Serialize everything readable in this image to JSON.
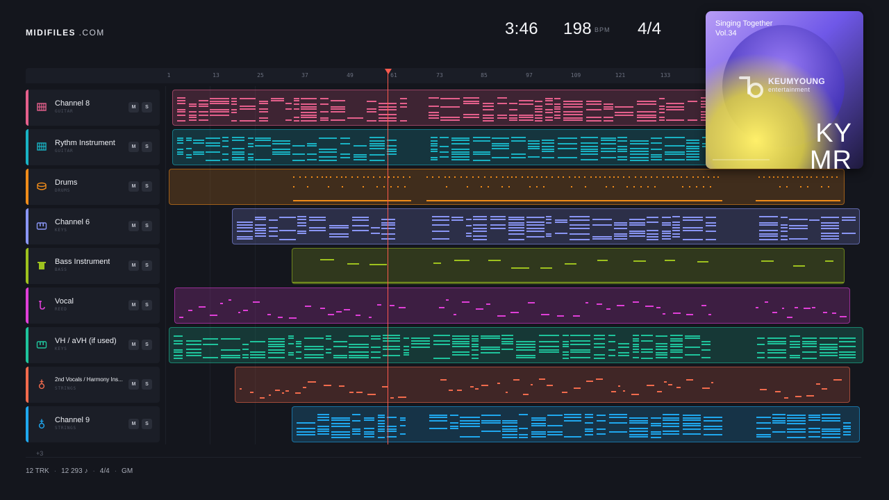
{
  "brand": {
    "name": "MIDIFILES",
    "suffix": ".COM"
  },
  "transport": {
    "time": "3:46",
    "bpm": "198",
    "bpm_unit": "BPM",
    "signature": "4/4"
  },
  "ruler": {
    "ticks": [
      "1",
      "13",
      "25",
      "37",
      "49",
      "61",
      "73",
      "85",
      "97",
      "109",
      "121",
      "133"
    ]
  },
  "tracks": [
    {
      "name": "Channel 8",
      "type": "GUITAR",
      "icon": "guitar-grid-icon",
      "color": "#e5608c",
      "mute": "M",
      "solo": "S"
    },
    {
      "name": "Rythm Instrument",
      "type": "GUITAR",
      "icon": "guitar-grid-icon",
      "color": "#19b3c4",
      "mute": "M",
      "solo": "S"
    },
    {
      "name": "Drums",
      "type": "DRUMS",
      "icon": "drum-icon",
      "color": "#f08c1a",
      "mute": "M",
      "solo": "S"
    },
    {
      "name": "Channel 6",
      "type": "KEYS",
      "icon": "keyboard-icon",
      "color": "#8a96f5",
      "mute": "M",
      "solo": "S"
    },
    {
      "name": "Bass Instrument",
      "type": "BASS",
      "icon": "bass-amp-icon",
      "color": "#9ec21e",
      "mute": "M",
      "solo": "S"
    },
    {
      "name": "Vocal",
      "type": "REED",
      "icon": "saxophone-icon",
      "color": "#e03fd8",
      "mute": "M",
      "solo": "S"
    },
    {
      "name": "VH / aVH (if used)",
      "type": "KEYS",
      "icon": "keyboard-icon",
      "color": "#1fc49c",
      "mute": "M",
      "solo": "S"
    },
    {
      "name": "2nd Vocals / Harmony Ins...",
      "type": "STRINGS",
      "icon": "violin-icon",
      "color": "#f26b4d",
      "mute": "M",
      "solo": "S"
    },
    {
      "name": "Channel 9",
      "type": "STRINGS",
      "icon": "violin-icon",
      "color": "#1fa8ef",
      "mute": "M",
      "solo": "S"
    }
  ],
  "more_tracks": "+3",
  "footer": {
    "tracks": "12 TRK",
    "notes": "12 293 ♪",
    "signature": "4/4",
    "standard": "GM"
  },
  "album": {
    "title_line1": "Singing Together",
    "title_line2": "Vol.34",
    "label_name": "KEUMYOUNG",
    "label_sub": "entertainment",
    "mark_top": "KY",
    "mark_bottom": "MR"
  },
  "colors": {
    "background": "#14161d",
    "playhead": "#ff5a4e"
  }
}
